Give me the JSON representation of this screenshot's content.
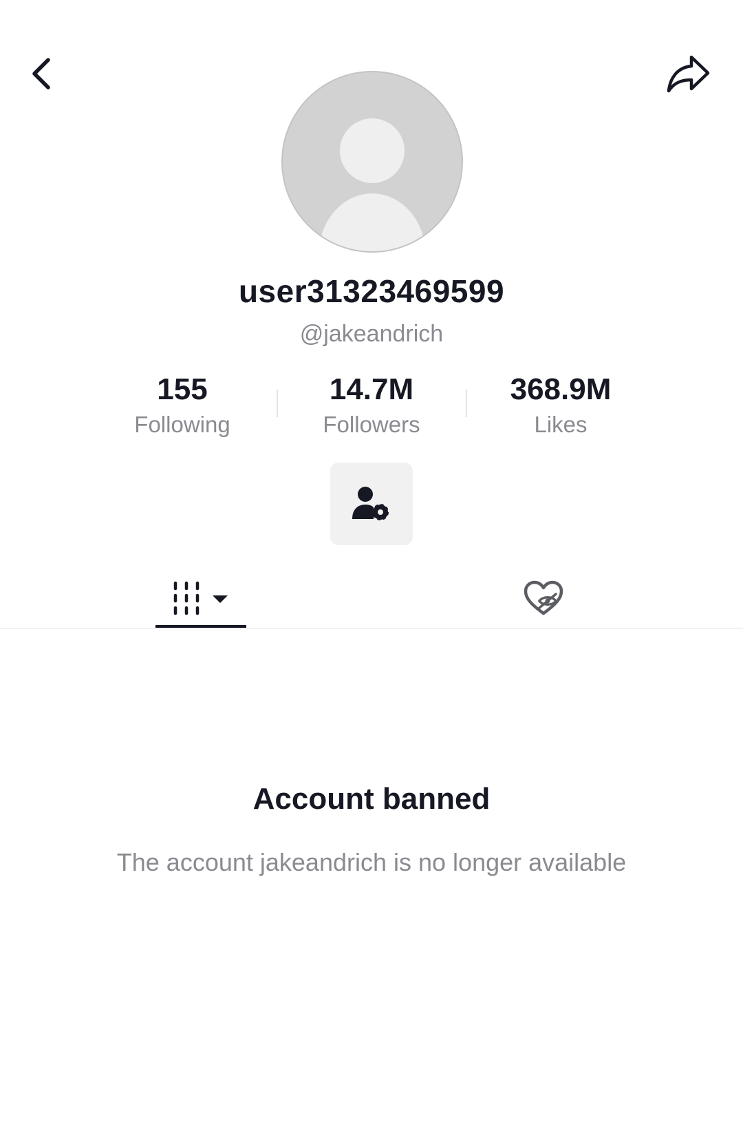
{
  "header": {
    "back_icon": "chevron-left-icon",
    "share_icon": "share-arrow-icon"
  },
  "profile": {
    "display_name": "user31323469599",
    "handle": "@jakeandrich",
    "avatar_icon": "default-avatar-icon"
  },
  "stats": [
    {
      "value": "155",
      "label": "Following"
    },
    {
      "value": "14.7M",
      "label": "Followers"
    },
    {
      "value": "368.9M",
      "label": "Likes"
    }
  ],
  "actions": {
    "manage_icon": "user-settings-icon"
  },
  "tabs": [
    {
      "icon": "videos-grid-icon",
      "active": true
    },
    {
      "icon": "liked-hidden-icon",
      "active": false
    }
  ],
  "notice": {
    "title": "Account banned",
    "message": "The account jakeandrich is no longer available"
  },
  "colors": {
    "text_primary": "#161823",
    "text_secondary": "#8a8b91",
    "avatar_bg": "#d2d2d3",
    "avatar_fg": "#efeff0",
    "button_bg": "#f1f1f2",
    "divider": "#e3e3e4"
  }
}
